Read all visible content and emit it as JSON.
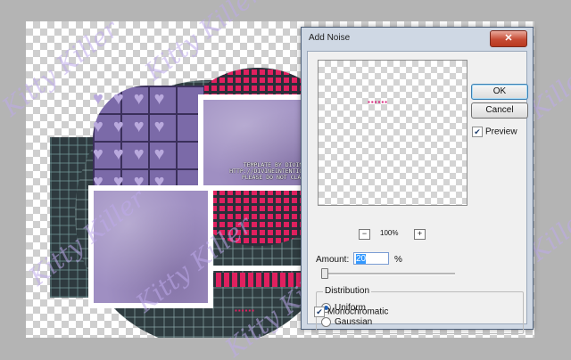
{
  "document": {
    "template_text": [
      "TEMPLATE BY DIVINE",
      "HTTP://DIVINEINTENTIONZ...",
      "PLEASE DO NOT CLAIM"
    ],
    "watermark": "Kitty Killer",
    "preview_dots": "▪▪▪▪▪▪"
  },
  "dialog": {
    "title": "Add Noise",
    "close_label": "✕",
    "ok_label": "OK",
    "cancel_label": "Cancel",
    "preview_label": "Preview",
    "preview_checked": true,
    "zoom_minus": "−",
    "zoom_plus": "+",
    "zoom_level": "100%",
    "amount_label": "Amount:",
    "amount_value": "20",
    "amount_unit": "%",
    "amount_percent": 20,
    "distribution": {
      "legend": "Distribution",
      "options": [
        "Uniform",
        "Gaussian"
      ],
      "selected": "Uniform"
    },
    "monochromatic_label": "Monochromatic",
    "monochromatic_checked": true
  },
  "colors": {
    "accent_pink": "#e0205f",
    "plaid_dark": "#2f3c40",
    "lavender_photo": "#9f8fc2",
    "dialog_frame": "#cfd8e4",
    "close_red": "#c64b34"
  }
}
